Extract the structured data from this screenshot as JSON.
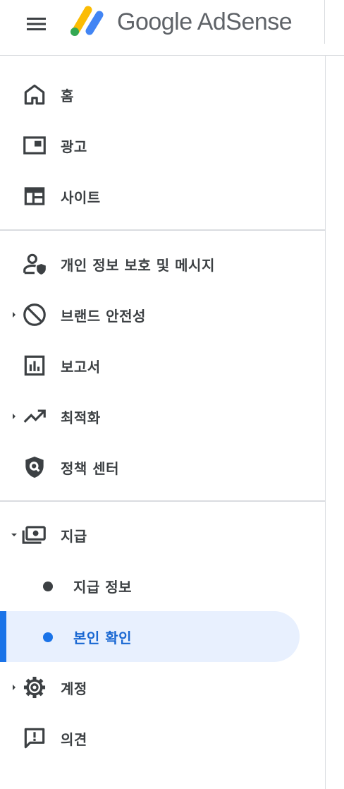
{
  "header": {
    "brand": "Google AdSense",
    "menu_icon": "hamburger-menu-icon",
    "logo_icon": "adsense-logo-icon",
    "logo_colors": [
      "#fbbc04",
      "#34a853",
      "#4285f4"
    ]
  },
  "nav": {
    "home": {
      "label": "홈",
      "icon": "home-icon"
    },
    "ads": {
      "label": "광고",
      "icon": "ads-icon"
    },
    "sites": {
      "label": "사이트",
      "icon": "web-icon"
    },
    "privacy": {
      "label": "개인 정보 보호 및 메시지",
      "icon": "privacy-shield-user-icon"
    },
    "brand_safety": {
      "label": "브랜드 안전성",
      "icon": "block-icon",
      "expandable": true
    },
    "reports": {
      "label": "보고서",
      "icon": "bar-chart-icon"
    },
    "optimization": {
      "label": "최적화",
      "icon": "trending-up-icon",
      "expandable": true
    },
    "policy": {
      "label": "정책 센터",
      "icon": "policy-shield-icon"
    },
    "payments": {
      "label": "지급",
      "icon": "payments-icon",
      "expanded": true,
      "children": {
        "payment_info": {
          "label": "지급 정보"
        },
        "verification": {
          "label": "본인 확인",
          "active": true
        }
      }
    },
    "account": {
      "label": "계정",
      "icon": "settings-gear-icon",
      "expandable": true
    },
    "feedback": {
      "label": "의견",
      "icon": "feedback-icon"
    }
  },
  "colors": {
    "active_bg": "#e8f0fe",
    "active_accent": "#1a73e8",
    "text": "#3c4043",
    "divider": "#dadce0"
  }
}
